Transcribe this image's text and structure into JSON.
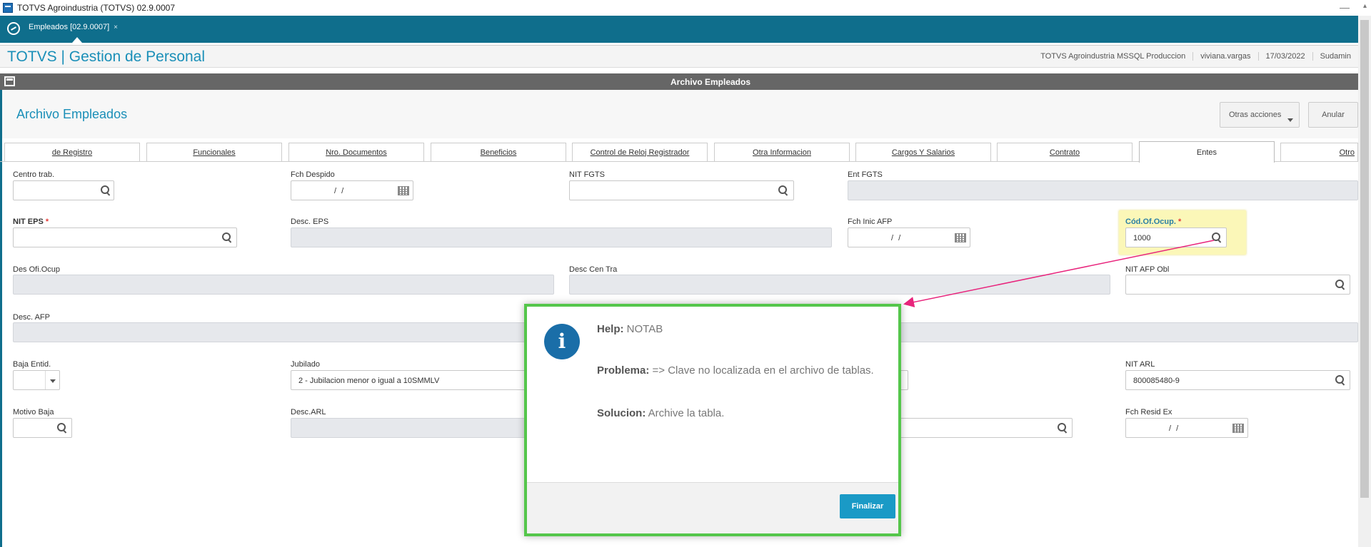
{
  "window": {
    "title": "TOTVS Agroindustria (TOTVS) 02.9.0007",
    "minimize": "—",
    "scroll_up": "▴"
  },
  "tabbar": {
    "tab_label": "Empleados [02.9.0007]",
    "tab_close": "×"
  },
  "header": {
    "app_title": "TOTVS | Gestion de Personal",
    "environment": "TOTVS Agroindustria MSSQL Produccion",
    "user": "viviana.vargas",
    "date": "17/03/2022",
    "company": "Sudamin"
  },
  "window_bar": {
    "title": "Archivo Empleados"
  },
  "page": {
    "title": "Archivo Empleados",
    "other_actions": "Otras acciones",
    "cancel": "Anular"
  },
  "folders": [
    "de Registro",
    "Funcionales",
    "Nro. Documentos",
    "Beneficios",
    "Control de Reloj Registrador",
    "Otra Informacion",
    "Cargos Y Salarios",
    "Contrato",
    "Entes",
    "Otro"
  ],
  "fields": {
    "centro_trab": {
      "label": "Centro trab.",
      "value": ""
    },
    "fch_despido": {
      "label": "Fch Despido",
      "value": "/ /"
    },
    "nit_fgts": {
      "label": "NIT FGTS",
      "value": ""
    },
    "ent_fgts": {
      "label": "Ent FGTS",
      "value": ""
    },
    "nit_eps": {
      "label": "NIT EPS",
      "required": "*",
      "value": ""
    },
    "desc_eps": {
      "label": "Desc. EPS",
      "value": ""
    },
    "fch_inic_afp": {
      "label": "Fch Inic AFP",
      "value": "/ /"
    },
    "cod_of_ocup": {
      "label": "Cód.Of.Ocup.",
      "required": "*",
      "value": "1000"
    },
    "des_ofi_ocup": {
      "label": "Des Ofi.Ocup",
      "value": ""
    },
    "desc_cen_tra": {
      "label": "Desc Cen Tra",
      "value": ""
    },
    "nit_afp_obl": {
      "label": "NIT AFP Obl",
      "value": ""
    },
    "desc_afp": {
      "label": "Desc. AFP",
      "value": ""
    },
    "baja_entid": {
      "label": "Baja Entid.",
      "value": ""
    },
    "jubilado": {
      "label": "Jubilado",
      "value": "2 - Jubilacion menor o igual a 10SMMLV"
    },
    "nit_arl": {
      "label": "NIT ARL",
      "value": "800085480-9"
    },
    "motivo_baja": {
      "label": "Motivo Baja",
      "value": ""
    },
    "desc_arl": {
      "label": "Desc.ARL",
      "value": ""
    },
    "fch_resid_ex": {
      "label": "Fch Resid Ex",
      "value": "/ /"
    }
  },
  "dialog": {
    "icon": "i",
    "help_label": "Help:",
    "help_value": "NOTAB",
    "problem_label": "Problema:",
    "problem_value": "=> Clave no localizada en el archivo de tablas.",
    "solution_label": "Solucion:",
    "solution_value": "Archive la tabla.",
    "button": "Finalizar"
  },
  "colors": {
    "accent": "#0f6e8c",
    "title_blue": "#1a8fb8",
    "dialog_border": "#55c64b",
    "button": "#1a9ac6"
  }
}
